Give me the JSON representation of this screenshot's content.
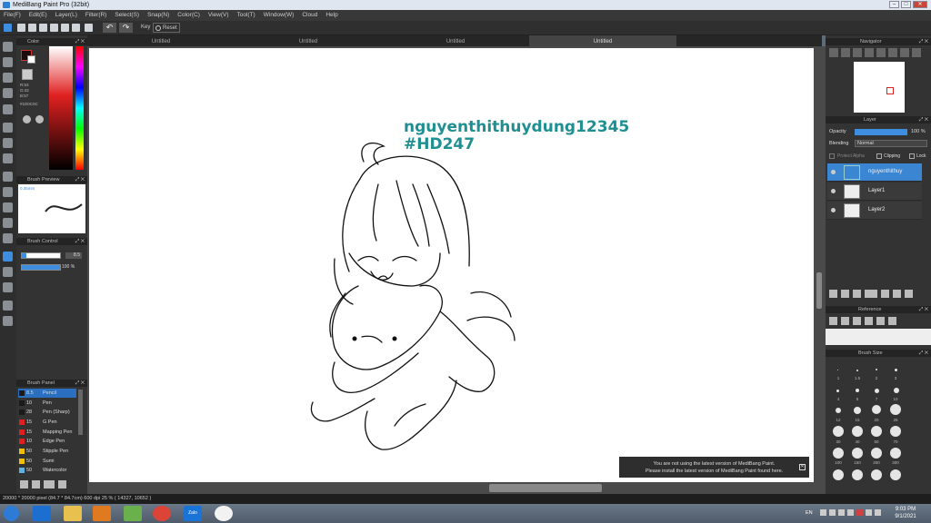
{
  "window": {
    "title": "MediBang Paint Pro (32bit)"
  },
  "menu": [
    "File(F)",
    "Edit(E)",
    "Layer(L)",
    "Filter(R)",
    "Select(S)",
    "Snap(N)",
    "Color(C)",
    "View(V)",
    "Tool(T)",
    "Window(W)",
    "Cloud",
    "Help"
  ],
  "toolbar": {
    "key_label": "Key",
    "reset_label": "Reset"
  },
  "tabs": [
    "Untitled",
    "Untitled",
    "Untitled",
    "Untitled"
  ],
  "color_panel": {
    "title": "Color",
    "r": "R:53",
    "g": "G:42",
    "b": "B:57",
    "hex": "#1D0C0C",
    "fg_color": "#1d0c0c",
    "bg_color": "#ffffff"
  },
  "brush_preview": {
    "title": "Brush Preview",
    "size": "0.35mm"
  },
  "brush_control": {
    "title": "Brush Control",
    "size_value": "8.5",
    "opacity_value": "100 %"
  },
  "brush_panel": {
    "title": "Brush Panel",
    "items": [
      {
        "size": "8.5",
        "name": "Pencil",
        "color": "#1a1a1a"
      },
      {
        "size": "10",
        "name": "Pen",
        "color": "#1a1a1a"
      },
      {
        "size": "28",
        "name": "Pen (Sharp)",
        "color": "#1a1a1a"
      },
      {
        "size": "15",
        "name": "G Pen",
        "color": "#e02020"
      },
      {
        "size": "15",
        "name": "Mapping Pen",
        "color": "#e02020"
      },
      {
        "size": "10",
        "name": "Edge Pen",
        "color": "#e02020"
      },
      {
        "size": "50",
        "name": "Stipple Pen",
        "color": "#f0c000"
      },
      {
        "size": "50",
        "name": "Sumi",
        "color": "#f0c000"
      },
      {
        "size": "50",
        "name": "Watercolor",
        "color": "#60b0e0"
      }
    ]
  },
  "canvas": {
    "watermark_line1": "nguyenthithuydung12345",
    "watermark_line2": "#HD247"
  },
  "notice": {
    "line1": "You are not using the latest version of MediBang Paint.",
    "line2": "Please install the latest version of MediBang Paint found here."
  },
  "navigator": {
    "title": "Navigator"
  },
  "layer_panel": {
    "title": "Layer",
    "opacity_label": "Opacity",
    "opacity_value": "100 %",
    "blending_label": "Blending",
    "blending_value": "Normal",
    "protect_alpha": "Protect Alpha",
    "clipping": "Clipping",
    "lock": "Lock",
    "layers": [
      {
        "name": "nguyenthithuy"
      },
      {
        "name": "Layer1"
      },
      {
        "name": "Layer2"
      }
    ]
  },
  "reference": {
    "title": "Reference"
  },
  "brush_size": {
    "title": "Brush Size",
    "labels": [
      "1",
      "1.5",
      "2",
      "3",
      "4",
      "5",
      "7",
      "10",
      "12",
      "15",
      "20",
      "25",
      "30",
      "40",
      "50",
      "70",
      "100",
      "150",
      "200",
      "300"
    ]
  },
  "status": {
    "text": "20000 * 20000 pixel  (84.7 * 84.7cm)  600 dpi  25 %  ( 14327, 10652 )"
  },
  "taskbar": {
    "time": "9:03 PM",
    "date": "9/1/2021",
    "lang": "EN",
    "zalo": "Zalo"
  }
}
